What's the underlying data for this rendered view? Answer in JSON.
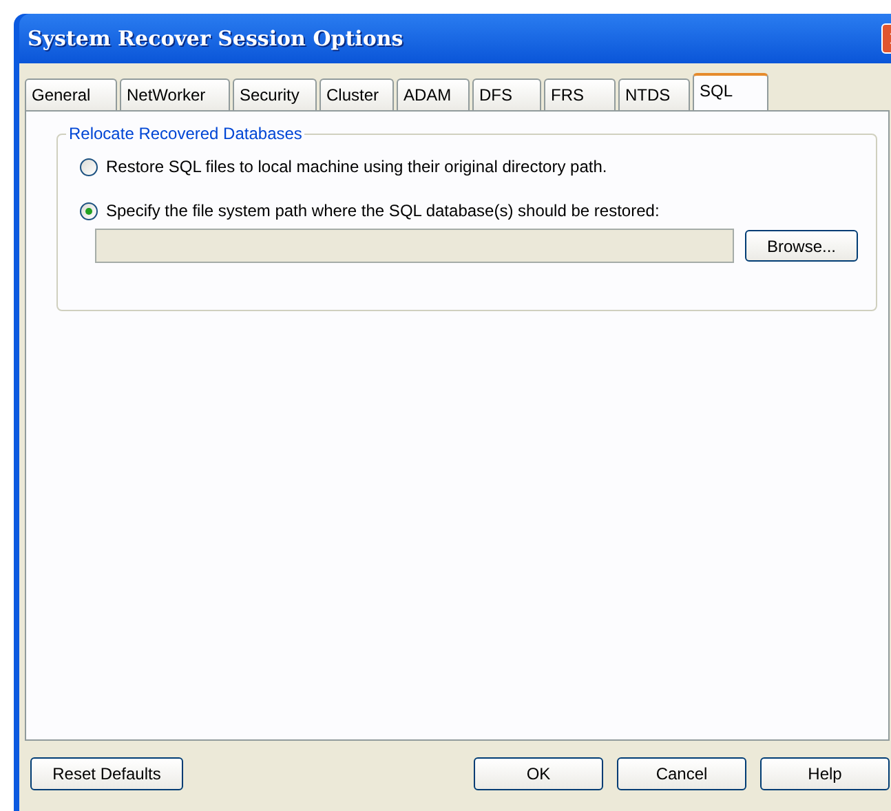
{
  "window": {
    "title": "System Recover Session Options"
  },
  "tabs": [
    {
      "label": "General",
      "selected": false
    },
    {
      "label": "NetWorker",
      "selected": false
    },
    {
      "label": "Security",
      "selected": false
    },
    {
      "label": "Cluster",
      "selected": false
    },
    {
      "label": "ADAM",
      "selected": false
    },
    {
      "label": "DFS",
      "selected": false
    },
    {
      "label": "FRS",
      "selected": false
    },
    {
      "label": "NTDS",
      "selected": false
    },
    {
      "label": "SQL",
      "selected": true
    }
  ],
  "group": {
    "title": "Relocate Recovered Databases",
    "options": [
      {
        "label": "Restore SQL files to local machine using their original directory path.",
        "selected": false
      },
      {
        "label": "Specify the file system path where the SQL database(s) should be restored:",
        "selected": true
      }
    ],
    "path_field": {
      "disabled": true
    },
    "browse_button": "Browse..."
  },
  "buttons": {
    "reset": "Reset Defaults",
    "actions": [
      "OK",
      "Cancel",
      "Help"
    ]
  }
}
